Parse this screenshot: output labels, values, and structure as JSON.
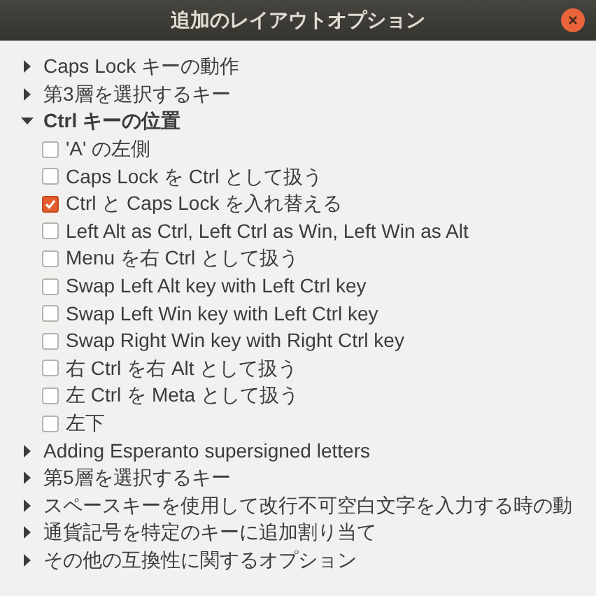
{
  "window": {
    "title": "追加のレイアウトオプション"
  },
  "groups": [
    {
      "label": "Caps Lock キーの動作",
      "expanded": false
    },
    {
      "label": "第3層を選択するキー",
      "expanded": false
    },
    {
      "label": "Ctrl キーの位置",
      "expanded": true,
      "options": [
        {
          "label": "'A' の左側",
          "checked": false
        },
        {
          "label": "Caps Lock を Ctrl として扱う",
          "checked": false
        },
        {
          "label": "Ctrl と Caps Lock を入れ替える",
          "checked": true
        },
        {
          "label": "Left Alt as Ctrl, Left Ctrl as Win, Left Win as Alt",
          "checked": false
        },
        {
          "label": "Menu を右 Ctrl として扱う",
          "checked": false
        },
        {
          "label": "Swap Left Alt key with Left Ctrl key",
          "checked": false
        },
        {
          "label": "Swap Left Win key with Left Ctrl key",
          "checked": false
        },
        {
          "label": "Swap Right Win key with Right Ctrl key",
          "checked": false
        },
        {
          "label": "右 Ctrl を右 Alt として扱う",
          "checked": false
        },
        {
          "label": "左 Ctrl を Meta として扱う",
          "checked": false
        },
        {
          "label": "左下",
          "checked": false
        }
      ]
    },
    {
      "label": "Adding Esperanto supersigned letters",
      "expanded": false
    },
    {
      "label": "第5層を選択するキー",
      "expanded": false
    },
    {
      "label": "スペースキーを使用して改行不可空白文字を入力する時の動",
      "expanded": false
    },
    {
      "label": "通貨記号を特定のキーに追加割り当て",
      "expanded": false
    },
    {
      "label": "その他の互換性に関するオプション",
      "expanded": false
    }
  ]
}
